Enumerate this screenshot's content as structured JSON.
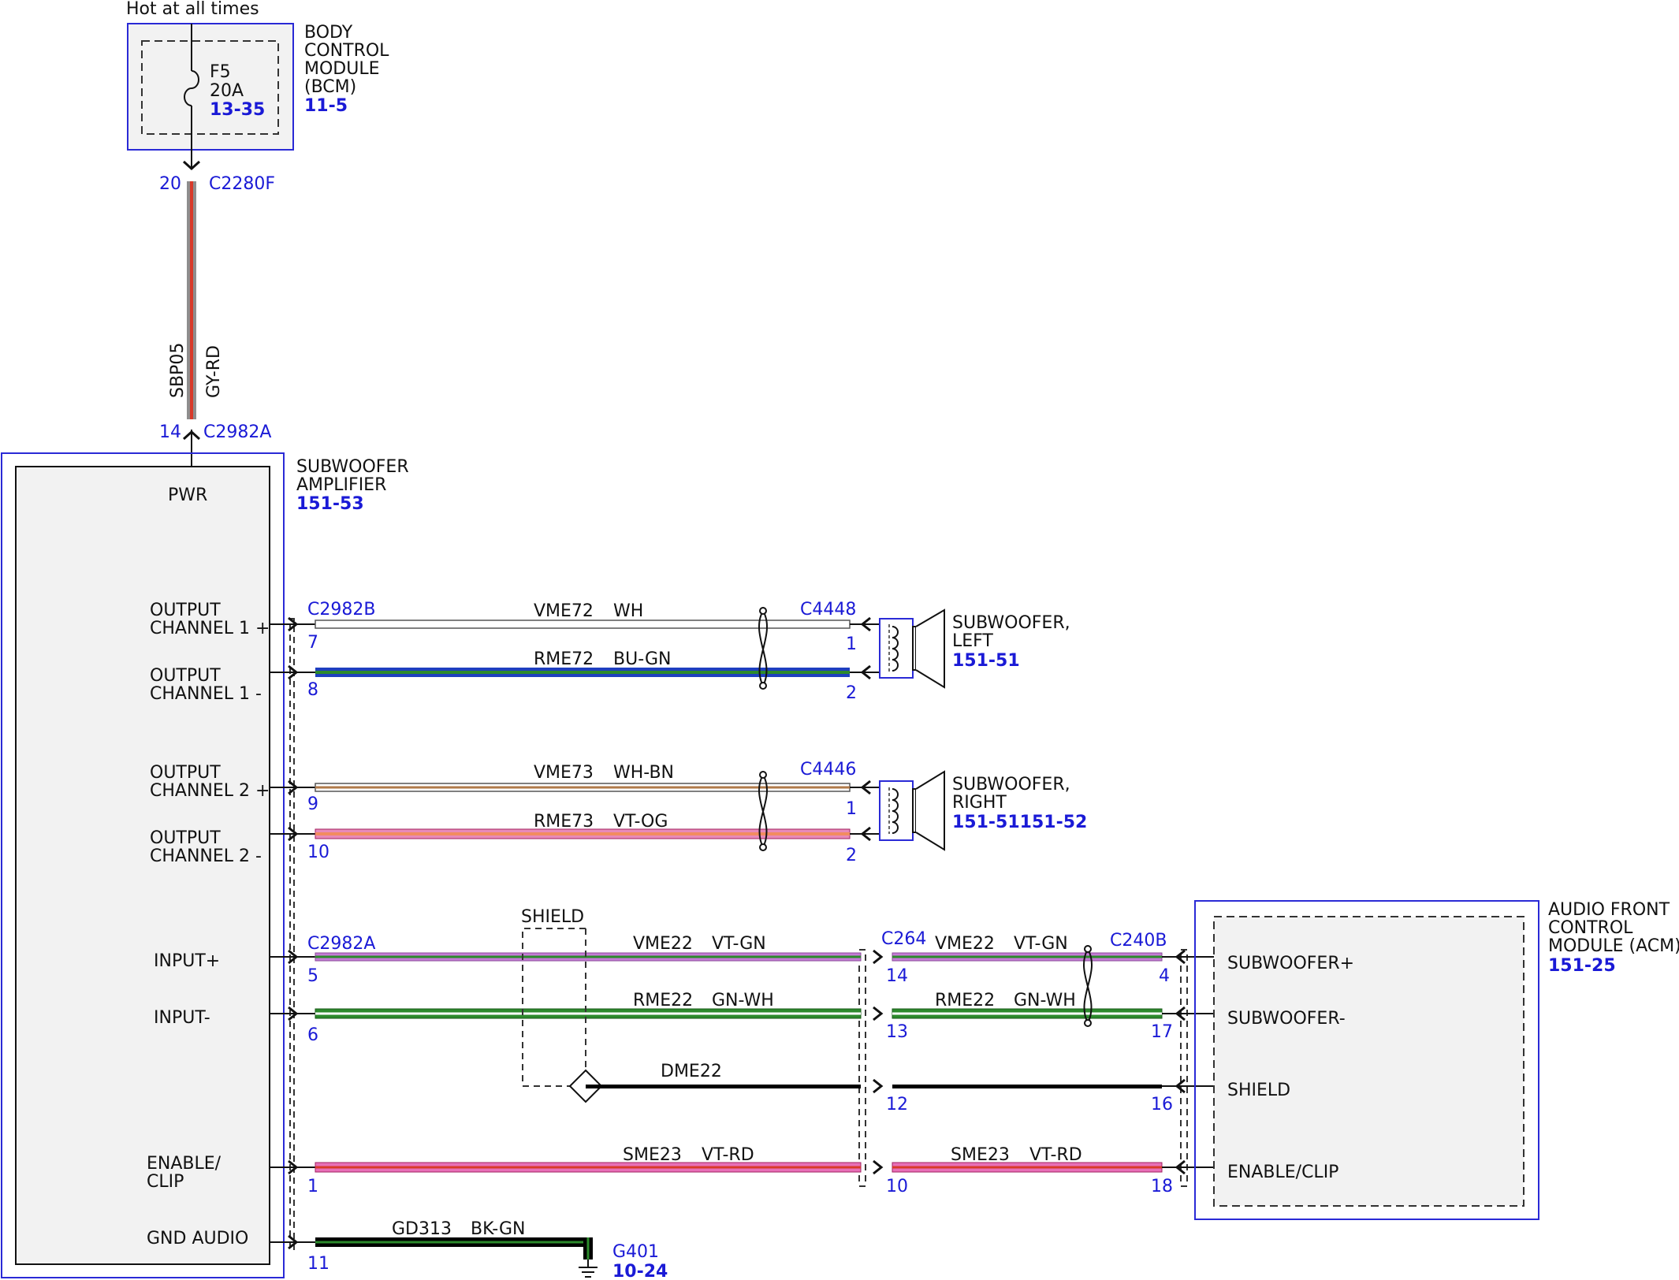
{
  "top_label": "Hot at all times",
  "bcm": {
    "title_lines": [
      "BODY",
      "CONTROL",
      "MODULE",
      "(BCM)"
    ],
    "ref": "11-5",
    "fuse": {
      "name": "F5",
      "rating": "20A",
      "ref": "13-35"
    }
  },
  "power_circuit": {
    "top_pin": "20",
    "top_connector": "C2280F",
    "circuit": "SBP05",
    "color": "GY-RD",
    "bottom_pin": "14",
    "bottom_connector": "C2982A"
  },
  "amplifier": {
    "title_lines": [
      "SUBWOOFER",
      "AMPLIFIER"
    ],
    "ref": "151-53",
    "pwr_label": "PWR",
    "labels": {
      "out1p": [
        "OUTPUT",
        "CHANNEL 1 +"
      ],
      "out1n": [
        "OUTPUT",
        "CHANNEL 1 -"
      ],
      "out2p": [
        "OUTPUT",
        "CHANNEL 2 +"
      ],
      "out2n": [
        "OUTPUT",
        "CHANNEL 2 -"
      ],
      "inp": "INPUT+",
      "inn": "INPUT-",
      "enable": [
        "ENABLE/",
        "CLIP"
      ],
      "gnd": "GND AUDIO"
    }
  },
  "wires": {
    "out1p": {
      "connector": "C2982B",
      "pin": "7",
      "circuit": "VME72",
      "color": "WH",
      "far_connector": "C4448",
      "far_pin": "1"
    },
    "out1n": {
      "pin": "8",
      "circuit": "RME72",
      "color": "BU-GN",
      "far_pin": "2"
    },
    "out2p": {
      "pin": "9",
      "circuit": "VME73",
      "color": "WH-BN",
      "far_connector": "C4446",
      "far_pin": "1"
    },
    "out2n": {
      "pin": "10",
      "circuit": "RME73",
      "color": "VT-OG",
      "far_pin": "2"
    },
    "inp": {
      "connector": "C2982A",
      "pin": "5",
      "circuit": "VME22",
      "color": "VT-GN",
      "mid_connector": "C264",
      "mid_pin": "14",
      "circuit2": "VME22",
      "color2": "VT-GN",
      "far_connector": "C240B",
      "far_pin": "4"
    },
    "inn": {
      "pin": "6",
      "circuit": "RME22",
      "color": "GN-WH",
      "mid_pin": "13",
      "circuit2": "RME22",
      "color2": "GN-WH",
      "far_pin": "17"
    },
    "shield": {
      "label": "SHIELD",
      "circuit": "DME22",
      "mid_pin": "12",
      "far_pin": "16"
    },
    "enable": {
      "pin": "1",
      "circuit": "SME23",
      "color": "VT-RD",
      "mid_pin": "10",
      "circuit2": "SME23",
      "color2": "VT-RD",
      "far_pin": "18"
    },
    "gnd": {
      "pin": "11",
      "circuit": "GD313",
      "color": "BK-GN",
      "ground": "G401",
      "ground_ref": "10-24"
    }
  },
  "sub_left": {
    "title_lines": [
      "SUBWOOFER,",
      "LEFT"
    ],
    "ref": "151-51"
  },
  "sub_right": {
    "title_lines": [
      "SUBWOOFER,",
      "RIGHT"
    ],
    "ref": "151-51151-52"
  },
  "acm": {
    "title_lines": [
      "AUDIO FRONT",
      "CONTROL",
      "MODULE (ACM)"
    ],
    "ref": "151-25",
    "pins": {
      "sub_p": "SUBWOOFER+",
      "sub_n": "SUBWOOFER-",
      "shield": "SHIELD",
      "enable": "ENABLE/CLIP"
    }
  },
  "colors": {
    "module_border": "#2a2ad6",
    "pin_text": "#1a1ad6",
    "wire_gy_rd": "#8e8e8e",
    "wire_rd": "#d83a2a",
    "wire_bu": "#1e3fbf",
    "wire_gn": "#2c8a2c",
    "wire_vt": "#c57cd6",
    "wire_pink": "#e86fb7",
    "wire_og": "#f28c60",
    "wire_bn": "#b07a4a",
    "wire_bk": "#000000"
  }
}
